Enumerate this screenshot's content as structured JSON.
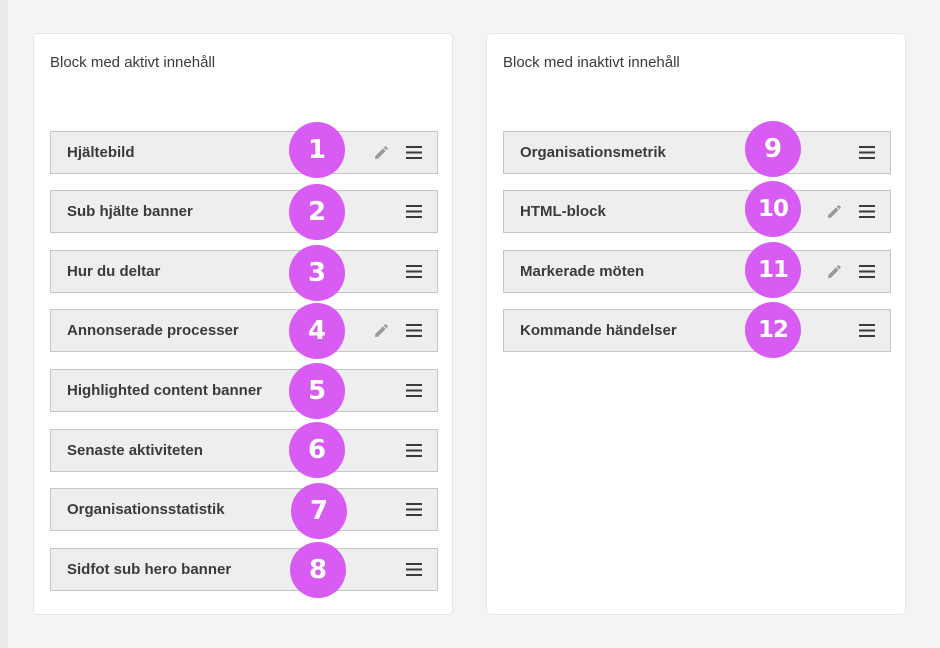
{
  "panels": {
    "active": {
      "title": "Block med aktivt innehåll",
      "rows": [
        {
          "label": "Hjältebild",
          "badge": "1",
          "editable": true
        },
        {
          "label": "Sub hjälte banner",
          "badge": "2",
          "editable": false
        },
        {
          "label": "Hur du deltar",
          "badge": "3",
          "editable": false
        },
        {
          "label": "Annonserade processer",
          "badge": "4",
          "editable": true
        },
        {
          "label": "Highlighted content banner",
          "badge": "5",
          "editable": false
        },
        {
          "label": "Senaste aktiviteten",
          "badge": "6",
          "editable": false
        },
        {
          "label": "Organisationsstatistik",
          "badge": "7",
          "editable": false
        },
        {
          "label": "Sidfot sub hero banner",
          "badge": "8",
          "editable": false
        }
      ]
    },
    "inactive": {
      "title": "Block med inaktivt innehåll",
      "rows": [
        {
          "label": "Organisationsmetrik",
          "badge": "9",
          "editable": false
        },
        {
          "label": "HTML-block",
          "badge": "10",
          "editable": true
        },
        {
          "label": "Markerade möten",
          "badge": "11",
          "editable": true
        },
        {
          "label": "Kommande händelser",
          "badge": "12",
          "editable": false
        }
      ]
    }
  },
  "icons": {
    "edit": "pencil-icon",
    "drag": "drag-handle-icon"
  },
  "colors": {
    "badge": "#d85cf4",
    "row_bg": "#eeeeee",
    "row_border": "#c6c6c6",
    "icon_gray": "#9a9a9a",
    "icon_dark": "#3d393c"
  }
}
